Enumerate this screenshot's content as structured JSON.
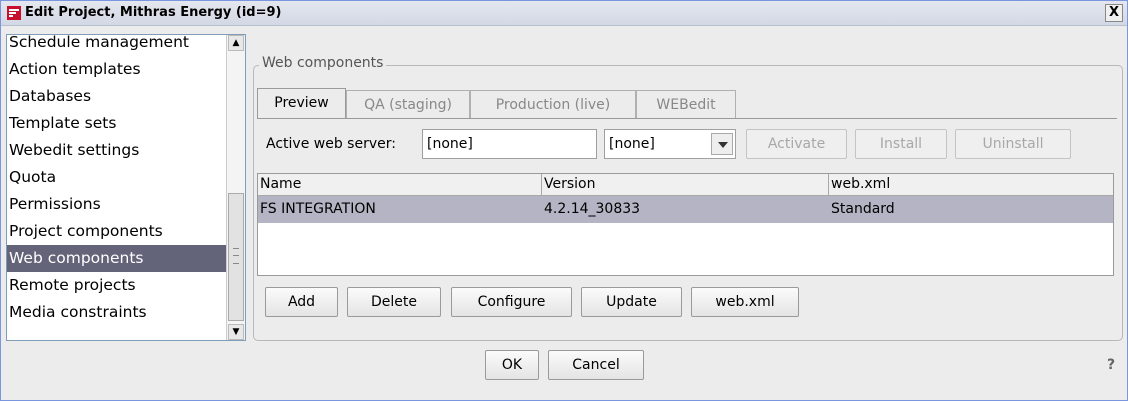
{
  "window": {
    "title": "Edit Project, Mithras Energy (id=9)",
    "close_glyph": "X",
    "app_icon": "firstspirit-icon"
  },
  "nav": {
    "items": [
      {
        "label": "Schedule management",
        "selected": false
      },
      {
        "label": "Action templates",
        "selected": false
      },
      {
        "label": "Databases",
        "selected": false
      },
      {
        "label": "Template sets",
        "selected": false
      },
      {
        "label": "Webedit settings",
        "selected": false
      },
      {
        "label": "Quota",
        "selected": false
      },
      {
        "label": "Permissions",
        "selected": false
      },
      {
        "label": "Project components",
        "selected": false
      },
      {
        "label": "Web components",
        "selected": true
      },
      {
        "label": "Remote projects",
        "selected": false
      },
      {
        "label": "Media constraints",
        "selected": false
      }
    ],
    "selected_color": "#636379"
  },
  "group": {
    "title": "Web components"
  },
  "tabs": [
    {
      "label": "Preview",
      "active": true
    },
    {
      "label": "QA (staging)",
      "active": false
    },
    {
      "label": "Production (live)",
      "active": false
    },
    {
      "label": "WEBedit",
      "active": false
    }
  ],
  "server": {
    "label": "Active web server:",
    "value": "[none]",
    "select_value": "[none]",
    "activate": "Activate",
    "install": "Install",
    "uninstall": "Uninstall"
  },
  "table": {
    "columns": [
      "Name",
      "Version",
      "web.xml"
    ],
    "rows": [
      {
        "name": "FS INTEGRATION",
        "version": "4.2.14_30833",
        "webxml": "Standard",
        "selected": true
      }
    ],
    "selected_row_color": "#b4b4c4"
  },
  "actions": {
    "add": "Add",
    "delete": "Delete",
    "configure": "Configure",
    "update": "Update",
    "webxml": "web.xml"
  },
  "footer": {
    "ok": "OK",
    "cancel": "Cancel",
    "help": "?"
  }
}
